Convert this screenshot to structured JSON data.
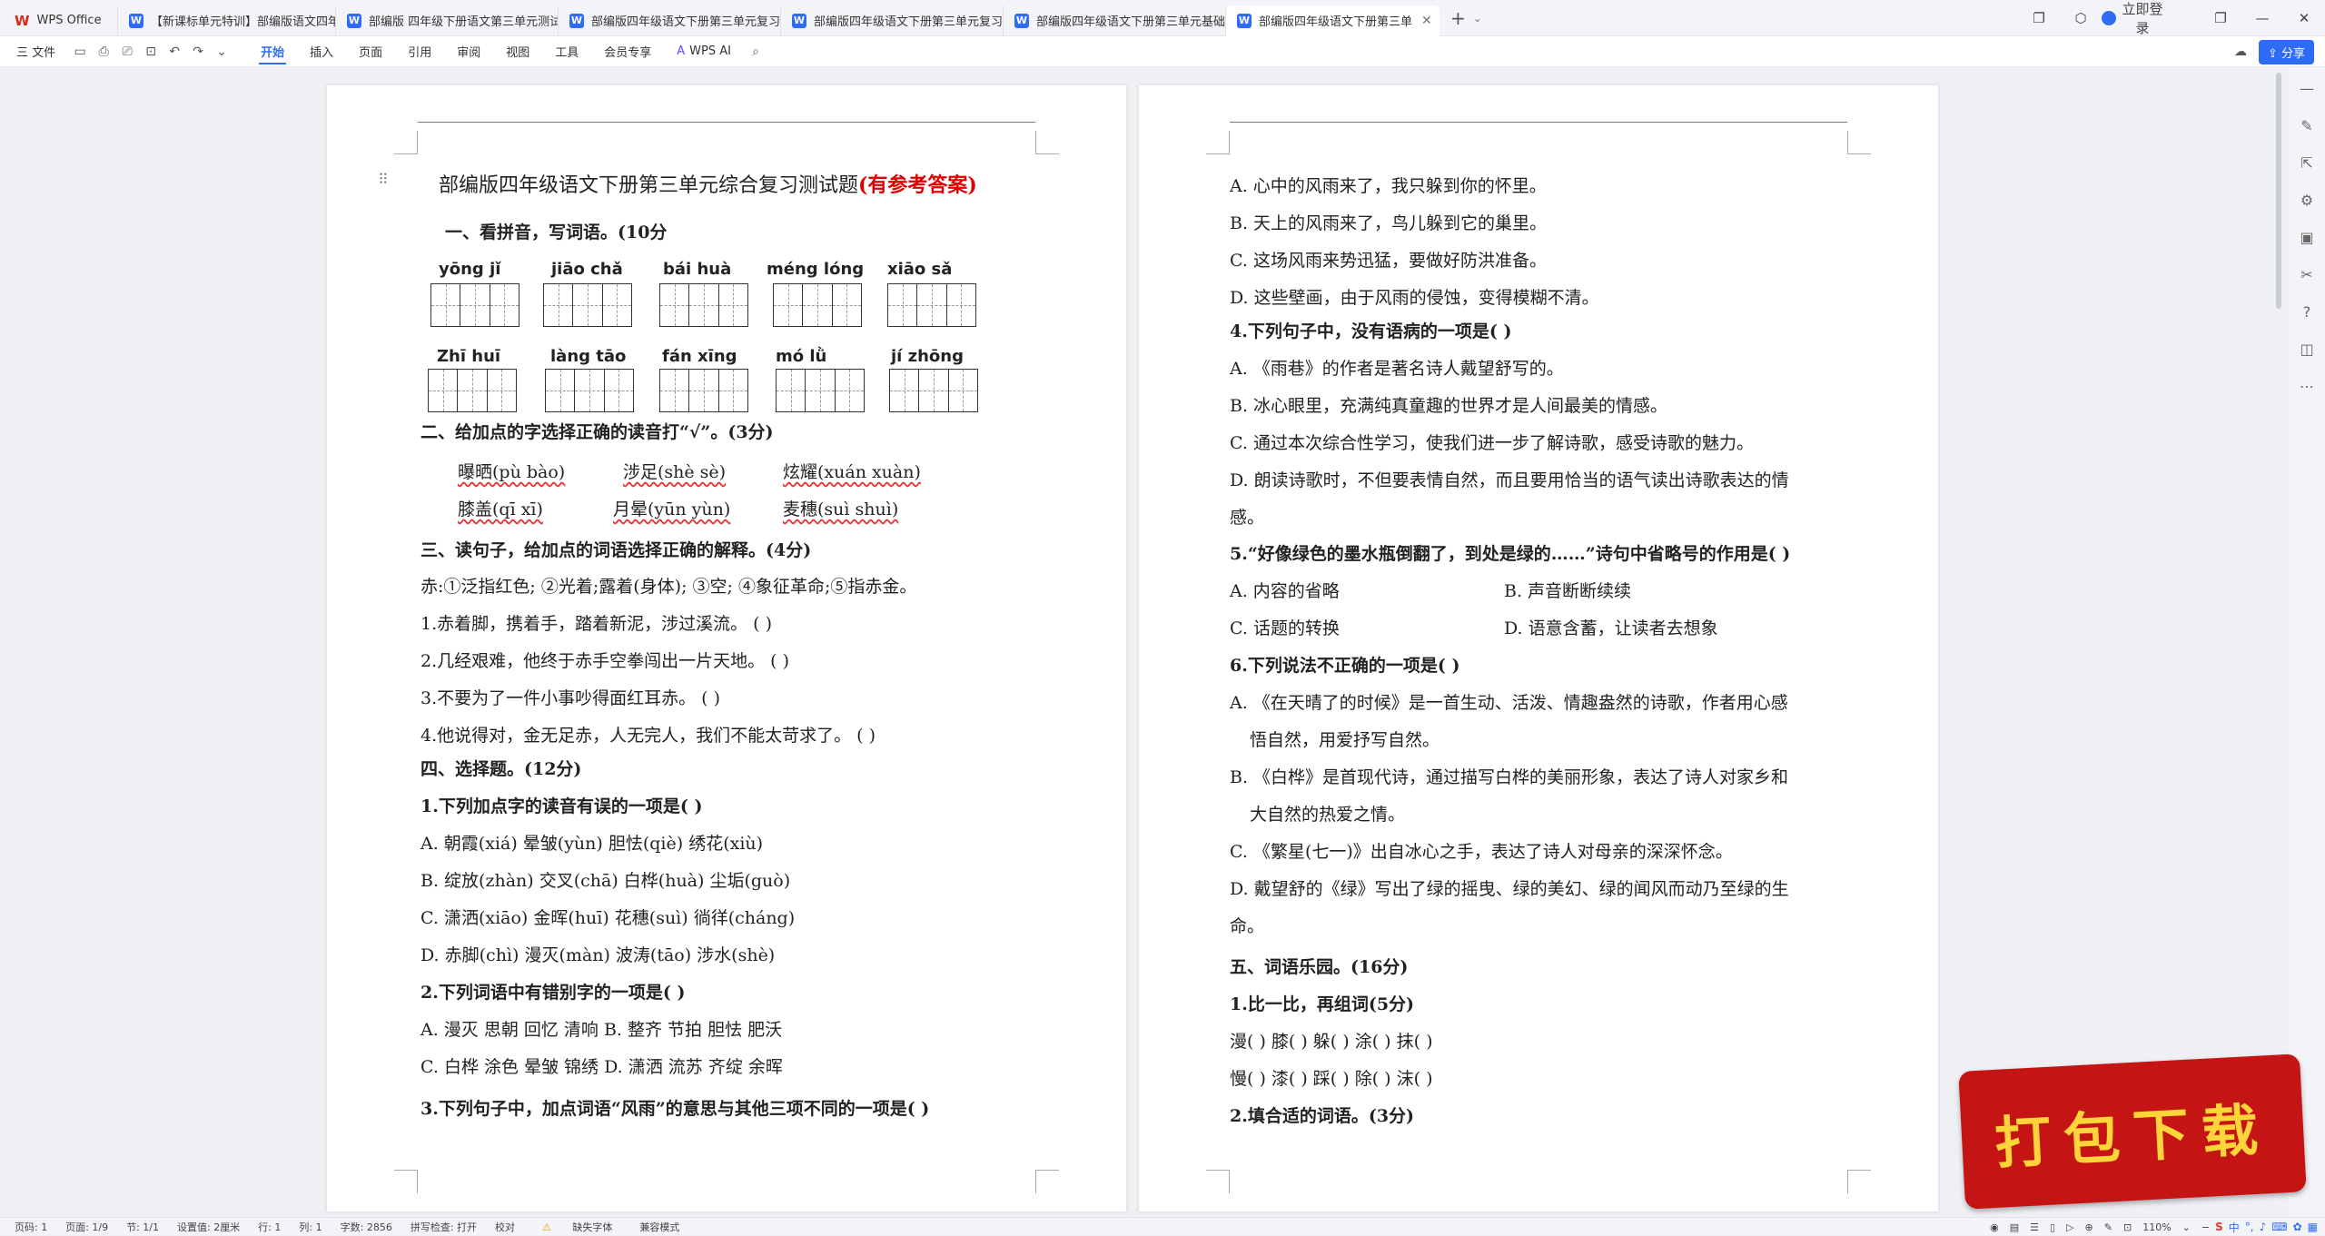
{
  "tabs": {
    "app": "WPS Office",
    "items": [
      "【新课标单元特训】部编版语文四年",
      "部编版 四年级下册语文第三单元测试",
      "部编版四年级语文下册第三单元复习",
      "部编版四年级语文下册第三单元复习",
      "部编版四年级语文下册第三单元基础",
      "部编版四年级语文下册第三单"
    ],
    "login": "立即登录"
  },
  "toolbar": {
    "file": "三 文件",
    "menus": [
      "开始",
      "插入",
      "页面",
      "引用",
      "审阅",
      "视图",
      "工具",
      "会员专享"
    ],
    "ai": "WPS AI",
    "share": "分享"
  },
  "page1": {
    "title": "部编版四年级语文下册第三单元综合复习测试题",
    "title_answer": "(有参考答案)",
    "s1": "一、看拼音，写词语。(10分",
    "pinyin_row1": [
      "yōng  jǐ",
      "jiāo  chǎ",
      "bái  huà",
      "méng  lóng",
      "xiāo  sǎ"
    ],
    "pinyin_row2": [
      "Zhī  huī",
      "làng  tāo",
      "fán  xīng",
      "mó  lǜ",
      "jí  zhōng"
    ],
    "s2": "二、给加点的字选择正确的读音打“√”。(3分)",
    "s2_l1a": "曝晒(pù  bào)",
    "s2_l1b": "涉足(shè  sè)",
    "s2_l1c": "炫耀(xuán  xuàn)",
    "s2_l2a": "膝盖(qī  xī)",
    "s2_l2b": "月晕(yūn  yùn)",
    "s2_l2c": "麦穗(suì  shuì)",
    "s3": "三、读句子，给加点的词语选择正确的解释。(4分)",
    "s3_def": "赤:①泛指红色;  ②光着;露着(身体);  ③空;  ④象征革命;⑤指赤金。",
    "s3_q1": "1.赤着脚，携着手，踏着新泥，涉过溪流。            (      )",
    "s3_q2": "2.几经艰难，他终于赤手空拳闯出一片天地。          (      )",
    "s3_q3": "3.不要为了一件小事吵得面红耳赤。                  (      )",
    "s3_q4": "4.他说得对，金无足赤，人无完人，我们不能太苛求了。    (      )",
    "s4": "四、选择题。(12分)",
    "q1": "1.下列加点字的读音有误的一项是(      )",
    "q1a": "A. 朝霞(xiá)       晕皱(yùn)      胆怯(qiè)       绣花(xiù)",
    "q1b": "B. 绽放(zhàn)       交叉(chā)       白桦(huà)       尘垢(guò)",
    "q1c": "C. 潇洒(xiāo)       金晖(huī)       花穗(suì)       徜徉(cháng)",
    "q1d": "D. 赤脚(chì)          漫灭(màn)      波涛(tāo)        涉水(shè)",
    "q2": "2.下列词语中有错别字的一项是(      )",
    "q2a": "A. 漫灭   思朝   回忆   清响          B. 整齐   节拍   胆怯   肥沃",
    "q2b": "C. 白桦   涂色   晕皱   锦绣          D. 潇洒   流苏   齐绽   余晖",
    "q3": "3.下列句子中，加点词语“风雨”的意思与其他三项不同的一项是(      )"
  },
  "page2": {
    "a": "A. 心中的风雨来了，我只躲到你的怀里。",
    "b": "B. 天上的风雨来了，鸟儿躲到它的巢里。",
    "c": "C. 这场风雨来势迅猛，要做好防洪准备。",
    "d": "D. 这些壁画，由于风雨的侵蚀，变得模糊不清。",
    "q4": "4.下列句子中，没有语病的一项是(      )",
    "q4a": "A. 《雨巷》的作者是著名诗人戴望舒写的。",
    "q4b": "B. 冰心眼里，充满纯真童趣的世界才是人间最美的情感。",
    "q4c": "C. 通过本次综合性学习，使我们进一步了解诗歌，感受诗歌的魅力。",
    "q4d": "D. 朗读诗歌时，不但要表情自然，而且要用恰当的语气读出诗歌表达的情",
    "q4d2": "感。",
    "q5": "5.“好像绿色的墨水瓶倒翻了，到处是绿的……”诗句中省略号的作用是(   )",
    "q5a": "A. 内容的省略",
    "q5b": "B. 声音断断续续",
    "q5c": "C. 话题的转换",
    "q5d": "D. 语意含蓄，让读者去想象",
    "q6": "6.下列说法不正确的一项是(      )",
    "q6a1": "A. 《在天晴了的时候》是一首生动、活泼、情趣盎然的诗歌，作者用心感",
    "q6a2": "悟自然，用爱抒写自然。",
    "q6b1": "B. 《白桦》是首现代诗，通过描写白桦的美丽形象，表达了诗人对家乡和",
    "q6b2": "大自然的热爱之情。",
    "q6c": "C. 《繁星(七一)》出自冰心之手，表达了诗人对母亲的深深怀念。",
    "q6d1": "D. 戴望舒的《绿》写出了绿的摇曳、绿的美幻、绿的闻风而动乃至绿的生",
    "q6d2": "命。",
    "s5": "五、词语乐园。(16分)",
    "s5_1": "1.比一比，再组词(5分)",
    "s5_r1": "漫(      )     膝(      )    躲(      )    涂(      )    抹(      )",
    "s5_r2": "慢(      )     漆(      )    踩(      )    除(      )    沫(      )",
    "s5_2": "2.填合适的词语。(3分)"
  },
  "status": {
    "page": "页码: 1",
    "pages": "页面: 1/9",
    "section": "节: 1/1",
    "setting": "设置值: 2厘米",
    "row": "行: 1",
    "col": "列: 1",
    "words": "字数: 2856",
    "spell": "拼写检查: 打开",
    "proof": "校对",
    "font": "缺失字体",
    "compat": "兼容模式",
    "zoom": "110%",
    "ime": "中"
  },
  "stamp": "打包下载",
  "colors": {
    "accent": "#2f6cf6",
    "answer": "#e00000",
    "stamp": "#c51414",
    "stamp_text": "#ffd43a"
  }
}
